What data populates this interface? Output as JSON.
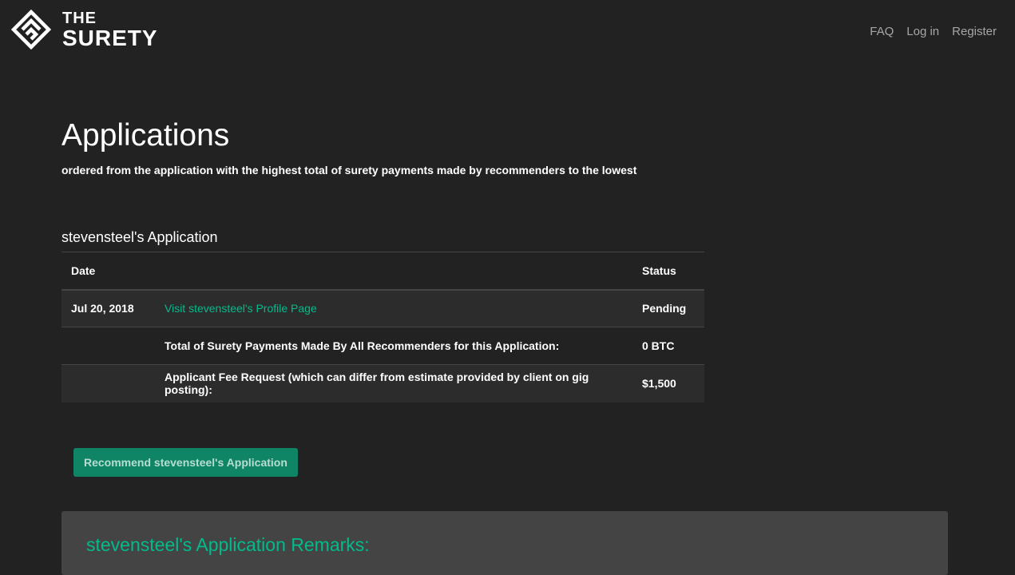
{
  "brand": {
    "line1": "THE",
    "line2": "SURETY"
  },
  "nav": {
    "faq": "FAQ",
    "login": "Log in",
    "register": "Register"
  },
  "page": {
    "title": "Applications",
    "subtitle": "ordered from the application with the highest total of surety payments made by recommenders to the lowest"
  },
  "application": {
    "title": "stevensteel's Application",
    "table": {
      "headers": {
        "date": "Date",
        "status": "Status"
      },
      "row": {
        "date": "Jul 20, 2018",
        "profile_link": "Visit stevensteel's Profile Page",
        "status": "Pending"
      },
      "total_payments": {
        "label": "Total of Surety Payments Made By All Recommenders for this Application:",
        "value": "0 BTC"
      },
      "fee_request": {
        "label": "Applicant Fee Request (which can differ from estimate provided by client on gig posting):",
        "value": "$1,500"
      }
    },
    "recommend_button": "Recommend stevensteel's Application",
    "remarks_title": "stevensteel's Application Remarks:"
  },
  "colors": {
    "background": "#222222",
    "accent": "#00bc8c",
    "stripe": "#2c2c2c",
    "panel": "#444444"
  }
}
